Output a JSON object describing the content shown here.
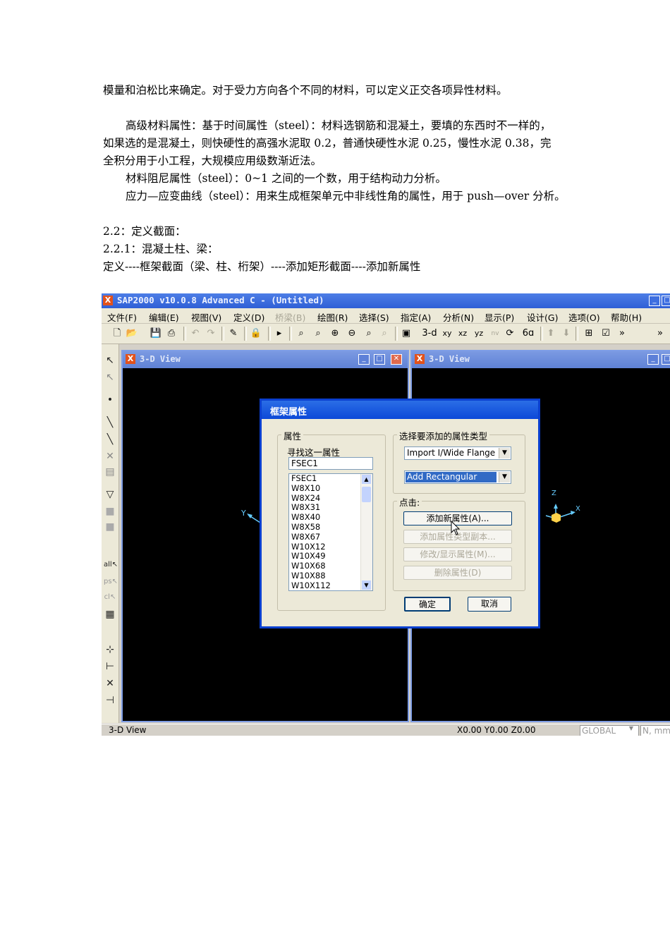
{
  "paragraphs": [
    "模量和泊松比来确定。对于受力方向各个不同的材料，可以定义正交各项异性材料。",
    "高级材料属性：基于时间属性（steel）：材料选钢筋和混凝土，要填的东西时不一样的，",
    "如果选的是混凝土，则快硬性的高强水泥取 0.2，普通快硬性水泥 0.25，慢性水泥 0.38，完",
    "全积分用于小工程，大规模应用级数渐近法。",
    "材料阻尼属性（steel）：0~1 之间的一个数，用于结构动力分析。",
    "应力—应变曲线（steel）：用来生成框架单元中非线性角的属性，用于 push—over 分析。",
    "2.2：定义截面：",
    "2.2.1：混凝土柱、梁：",
    "定义----框架截面（梁、柱、桁架）----添加矩形截面----添加新属性"
  ],
  "app": {
    "title": "SAP2000 v10.0.8 Advanced C  - (Untitled)",
    "menu": [
      "文件(F)",
      "编辑(E)",
      "视图(V)",
      "定义(D)",
      "桥梁(B)",
      "绘图(R)",
      "选择(S)",
      "指定(A)",
      "分析(N)",
      "显示(P)",
      "设计(G)",
      "选项(O)",
      "帮助(H)"
    ],
    "toolbar_text": [
      "3-d",
      "xy",
      "xz",
      "yz",
      "nv",
      "»"
    ],
    "view_title_left": "3-D View",
    "view_title_right": "3-D View",
    "axis_y": "Y",
    "axis_z": "Z",
    "axis_x": "X",
    "status_left": "3-D View",
    "status_coords": "X0.00  Y0.00  Z0.00",
    "status_global": "GLOBAL",
    "status_units": "N, mm,"
  },
  "dialog": {
    "title": "框架属性",
    "properties_group": "属性",
    "find_label": "寻找这一属性",
    "find_value": "FSEC1",
    "list_items": [
      "FSEC1",
      "W8X10",
      "W8X24",
      "W8X31",
      "W8X40",
      "W8X58",
      "W8X67",
      "W10X12",
      "W10X49",
      "W10X68",
      "W10X88",
      "W10X112"
    ],
    "type_group": "选择要添加的属性类型",
    "combo1": "Import I/Wide Flange",
    "combo2": "Add Rectangular",
    "click_group": "点击:",
    "btn_add_new": "添加新属性(A)...",
    "btn_add_copy": "添加属性类型副本...",
    "btn_modify": "修改/显示属性(M)...",
    "btn_delete": "删除属性(D)",
    "ok": "确定",
    "cancel": "取消"
  }
}
